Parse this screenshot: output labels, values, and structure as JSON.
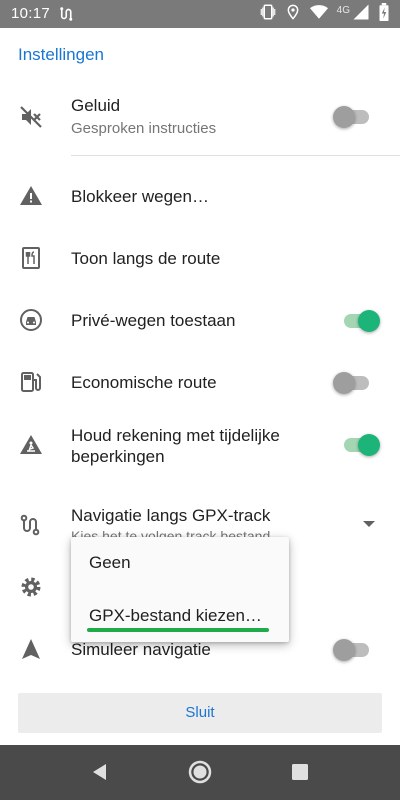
{
  "status_bar": {
    "time": "10:17",
    "network_label": "4G",
    "icons": [
      "route-icon",
      "vibrate-icon",
      "location-icon",
      "wifi-icon",
      "signal-icon",
      "battery-charging-icon"
    ]
  },
  "dialog": {
    "title": "Instellingen",
    "settings": [
      {
        "label": "Geluid",
        "sub": "Gesproken instructies",
        "icon": "sound-off-icon",
        "toggle": false
      },
      {
        "label": "Blokkeer wegen…",
        "icon": "warning-icon"
      },
      {
        "label": "Toon langs de route",
        "icon": "restaurant-icon"
      },
      {
        "label": "Privé-wegen toestaan",
        "icon": "car-circle-icon",
        "toggle": true
      },
      {
        "label": "Economische route",
        "icon": "fuel-icon",
        "toggle": false
      },
      {
        "label": "Houd rekening met tijdelijke beperkingen",
        "label_line1": "Houd rekening met tijdelijke",
        "label_line2": "beperkingen",
        "icon": "roadwork-icon",
        "toggle": true
      },
      {
        "label": "Navigatie langs GPX-track",
        "sub": "Kies het te volgen track bestand",
        "icon": "route-icon",
        "dropdown": true
      },
      {
        "label": "",
        "icon": "gear-icon"
      },
      {
        "label": "Simuleer navigatie",
        "icon": "navigation-arrow-icon",
        "toggle": false
      }
    ],
    "dropdown_options": [
      "Geen",
      "GPX-bestand kiezen…"
    ],
    "close_button": "Sluit"
  },
  "nav_bar": {
    "buttons": [
      "back-icon",
      "home-icon",
      "recents-icon"
    ]
  },
  "colors": {
    "accent": "#1976d2",
    "toggle_on": "#1db47a",
    "toggle_off": "#9e9e9e",
    "highlight": "#1fab4a",
    "status_bar": "#7a7a7a",
    "nav_bar": "#4a4a4a"
  }
}
